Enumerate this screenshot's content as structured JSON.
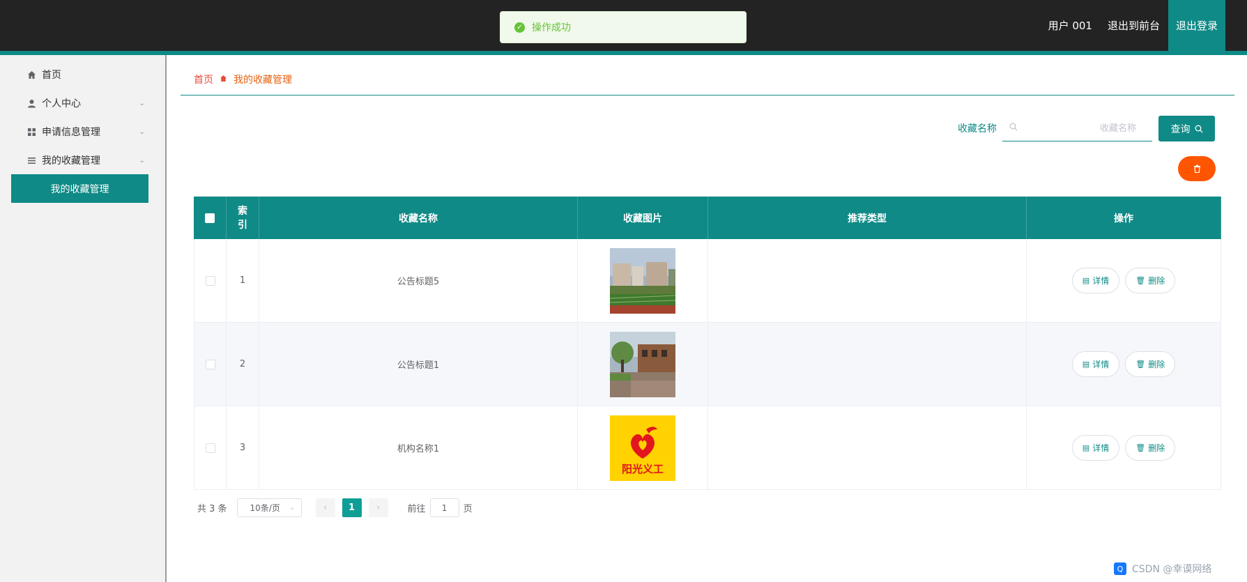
{
  "header": {
    "user_label": "用户 001",
    "to_front_label": "退出到前台",
    "logout_label": "退出登录"
  },
  "toast": {
    "message": "操作成功"
  },
  "sidebar": {
    "items": [
      {
        "label": "首页",
        "icon": "home-icon"
      },
      {
        "label": "个人中心",
        "icon": "user-icon"
      },
      {
        "label": "申请信息管理",
        "icon": "grid-icon"
      },
      {
        "label": "我的收藏管理",
        "icon": "menu-icon"
      }
    ],
    "active_submenu": "我的收藏管理"
  },
  "breadcrumb": {
    "home": "首页",
    "current": "我的收藏管理"
  },
  "search": {
    "label": "收藏名称",
    "placeholder": "收藏名称",
    "button_label": "查询"
  },
  "table": {
    "columns": [
      "索引",
      "收藏名称",
      "收藏图片",
      "推荐类型",
      "操作"
    ],
    "rows": [
      {
        "index": "1",
        "name": "公告标题5",
        "image": "campus-building-photo",
        "type": ""
      },
      {
        "index": "2",
        "name": "公告标题1",
        "image": "campus-garden-photo",
        "type": ""
      },
      {
        "index": "3",
        "name": "机构名称1",
        "image": "sunshine-volunteer-logo",
        "type": "",
        "logo_text": "阳光义工"
      }
    ],
    "detail_label": "详情",
    "delete_label": "删除"
  },
  "pagination": {
    "total_text": "共 3 条",
    "page_size": "10条/页",
    "current_page": "1",
    "goto_label": "前往",
    "goto_value": "1",
    "page_suffix": "页"
  },
  "watermark": {
    "text": "CSDN @幸谟网络"
  },
  "colors": {
    "primary": "#0f8a86",
    "danger": "#ff5500",
    "topbar": "#232323"
  }
}
